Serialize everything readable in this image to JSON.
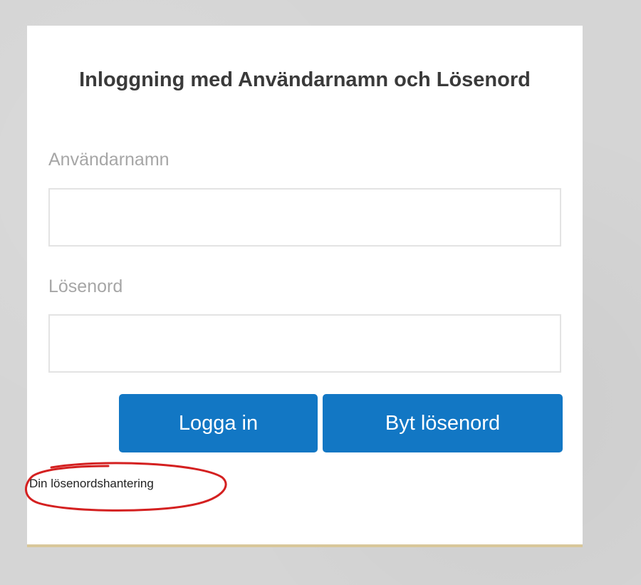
{
  "login": {
    "title": "Inloggning med Användarnamn och Lösenord",
    "username_label": "Användarnamn",
    "username_value": "",
    "password_label": "Lösenord",
    "password_value": "",
    "login_button": "Logga in",
    "change_password_button": "Byt lösenord",
    "password_management_link": "Din lösenordshantering"
  },
  "colors": {
    "button_blue": "#1277c4",
    "annotation_red": "#d42020",
    "card_accent": "#d8c79a"
  },
  "icons": {
    "annotation": "red-hand-drawn-circle"
  }
}
